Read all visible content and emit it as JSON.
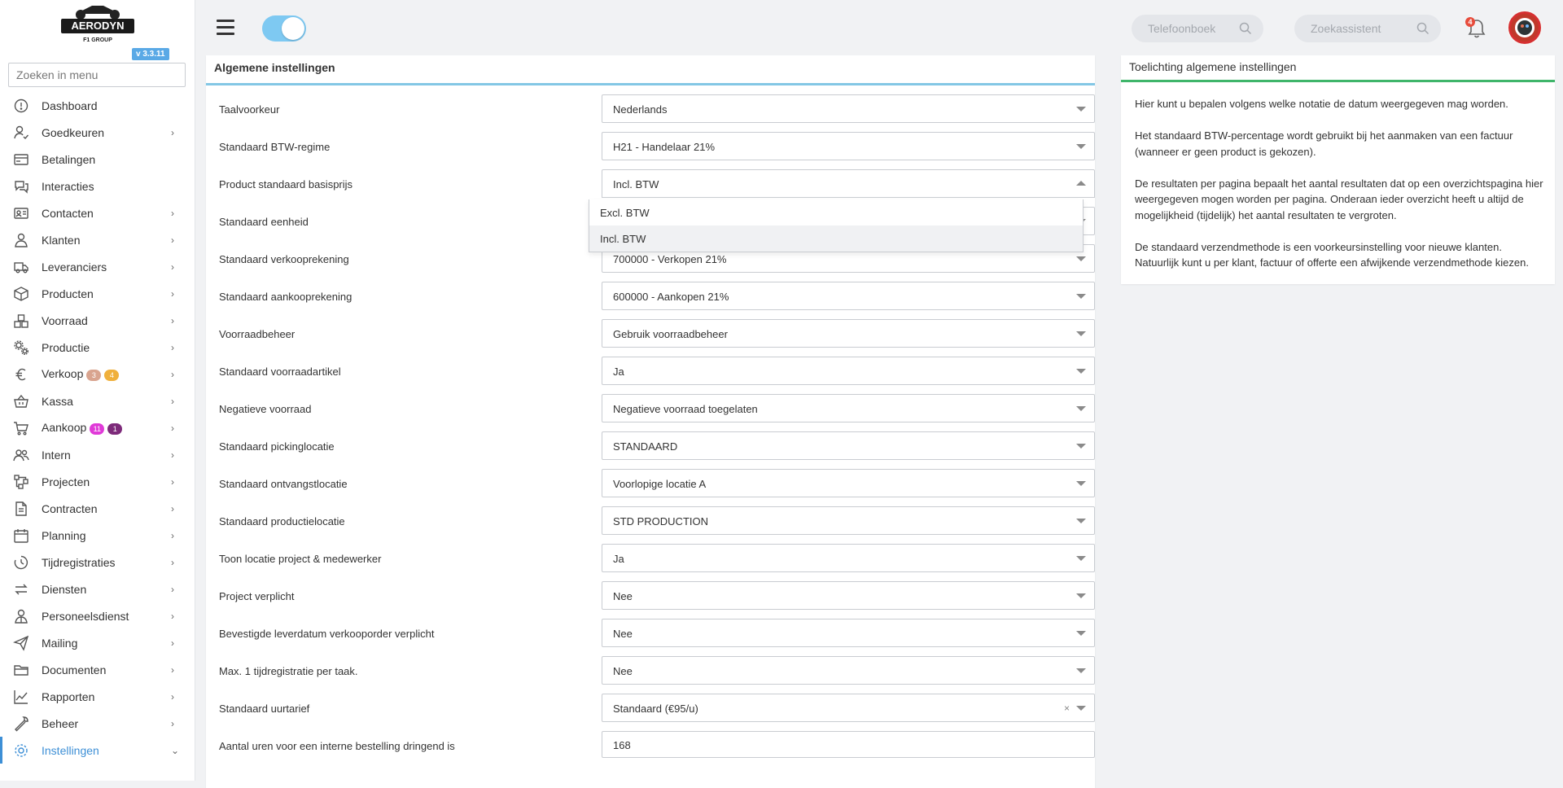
{
  "app": {
    "logo_text": "AERODYN",
    "logo_subtext": "F1 GROUP",
    "version": "v 3.3.11"
  },
  "sidebar": {
    "search_placeholder": "Zoeken in menu",
    "items": [
      {
        "label": "Dashboard",
        "icon": "dashboard-icon",
        "chevron": false
      },
      {
        "label": "Goedkeuren",
        "icon": "user-check-icon",
        "chevron": true
      },
      {
        "label": "Betalingen",
        "icon": "payments-icon",
        "chevron": false
      },
      {
        "label": "Interacties",
        "icon": "chat-icon",
        "chevron": false
      },
      {
        "label": "Contacten",
        "icon": "contacts-icon",
        "chevron": true
      },
      {
        "label": "Klanten",
        "icon": "customer-icon",
        "chevron": true
      },
      {
        "label": "Leveranciers",
        "icon": "truck-icon",
        "chevron": true
      },
      {
        "label": "Producten",
        "icon": "box-icon",
        "chevron": true
      },
      {
        "label": "Voorraad",
        "icon": "stock-icon",
        "chevron": true
      },
      {
        "label": "Productie",
        "icon": "gears-icon",
        "chevron": true
      },
      {
        "label": "Verkoop",
        "icon": "euro-icon",
        "chevron": true,
        "badges": [
          {
            "text": "3",
            "color": "#d9a48f"
          },
          {
            "text": "4",
            "color": "#f0b03c"
          }
        ]
      },
      {
        "label": "Kassa",
        "icon": "basket-icon",
        "chevron": true
      },
      {
        "label": "Aankoop",
        "icon": "cart-icon",
        "chevron": true,
        "badges": [
          {
            "text": "11",
            "color": "#e03ad8"
          },
          {
            "text": "1",
            "color": "#7d2a7a"
          }
        ]
      },
      {
        "label": "Intern",
        "icon": "team-icon",
        "chevron": true
      },
      {
        "label": "Projecten",
        "icon": "project-icon",
        "chevron": true
      },
      {
        "label": "Contracten",
        "icon": "contract-icon",
        "chevron": true
      },
      {
        "label": "Planning",
        "icon": "calendar-icon",
        "chevron": true
      },
      {
        "label": "Tijdregistraties",
        "icon": "clock-icon",
        "chevron": true
      },
      {
        "label": "Diensten",
        "icon": "exchange-icon",
        "chevron": true
      },
      {
        "label": "Personeelsdienst",
        "icon": "staff-icon",
        "chevron": true
      },
      {
        "label": "Mailing",
        "icon": "send-icon",
        "chevron": true
      },
      {
        "label": "Documenten",
        "icon": "folder-icon",
        "chevron": true
      },
      {
        "label": "Rapporten",
        "icon": "chart-icon",
        "chevron": true
      },
      {
        "label": "Beheer",
        "icon": "wrench-icon",
        "chevron": true
      },
      {
        "label": "Instellingen",
        "icon": "settings-icon",
        "chevron": true,
        "active": true
      }
    ]
  },
  "topbar": {
    "phonebook_placeholder": "Telefoonboek",
    "assistant_placeholder": "Zoekassistent",
    "notification_count": "4"
  },
  "main": {
    "title": "Algemene instellingen",
    "rows": [
      {
        "label": "Taalvoorkeur",
        "value": "Nederlands",
        "type": "select"
      },
      {
        "label": "Standaard BTW-regime",
        "value": "H21 - Handelaar 21%",
        "type": "select"
      },
      {
        "label": "Product standaard basisprijs",
        "value": "Incl. BTW",
        "type": "select",
        "open": true
      },
      {
        "label": "Standaard eenheid",
        "value": "",
        "type": "select"
      },
      {
        "label": "Standaard verkooprekening",
        "value": "700000 - Verkopen 21%",
        "type": "select"
      },
      {
        "label": "Standaard aankooprekening",
        "value": "600000 - Aankopen 21%",
        "type": "select"
      },
      {
        "label": "Voorraadbeheer",
        "value": "Gebruik voorraadbeheer",
        "type": "select"
      },
      {
        "label": "Standaard voorraadartikel",
        "value": "Ja",
        "type": "select"
      },
      {
        "label": "Negatieve voorraad",
        "value": "Negatieve voorraad toegelaten",
        "type": "select"
      },
      {
        "label": "Standaard pickinglocatie",
        "value": "STANDAARD",
        "type": "select"
      },
      {
        "label": "Standaard ontvangstlocatie",
        "value": "Voorlopige locatie A",
        "type": "select"
      },
      {
        "label": "Standaard productielocatie",
        "value": "STD PRODUCTION",
        "type": "select"
      },
      {
        "label": "Toon locatie project & medewerker",
        "value": "Ja",
        "type": "select"
      },
      {
        "label": "Project verplicht",
        "value": "Nee",
        "type": "select"
      },
      {
        "label": "Bevestigde leverdatum verkooporder verplicht",
        "value": "Nee",
        "type": "select"
      },
      {
        "label": "Max. 1 tijdregistratie per taak.",
        "value": "Nee",
        "type": "select"
      },
      {
        "label": "Standaard uurtarief",
        "value": "Standaard (€95/u)",
        "type": "select",
        "clearable": true
      },
      {
        "label": "Aantal uren voor een interne bestelling dringend is",
        "value": "168",
        "type": "input"
      }
    ],
    "dropdown_options": [
      "Excl. BTW",
      "Incl. BTW"
    ],
    "dropdown_highlighted": "Incl. BTW"
  },
  "help": {
    "title": "Toelichting algemene instellingen",
    "paragraphs": [
      "Hier kunt u bepalen volgens welke notatie de datum weergegeven mag worden.",
      "Het standaard BTW-percentage wordt gebruikt bij het aanmaken van een factuur (wanneer er geen product is gekozen).",
      "De resultaten per pagina bepaalt het aantal resultaten dat op een overzichtspagina hier weergegeven mogen worden per pagina. Onderaan ieder overzicht heeft u altijd de mogelijkheid (tijdelijk) het aantal resultaten te vergroten.",
      "De standaard verzendmethode is een voorkeursinstelling voor nieuwe klanten. Natuurlijk kunt u per klant, factuur of offerte een afwijkende verzendmethode kiezen."
    ]
  },
  "colors": {
    "accent": "#3d8fd6",
    "panel_line": "#83c7e5",
    "help_line": "#3fb56a",
    "toggle": "#7ec9f2"
  }
}
